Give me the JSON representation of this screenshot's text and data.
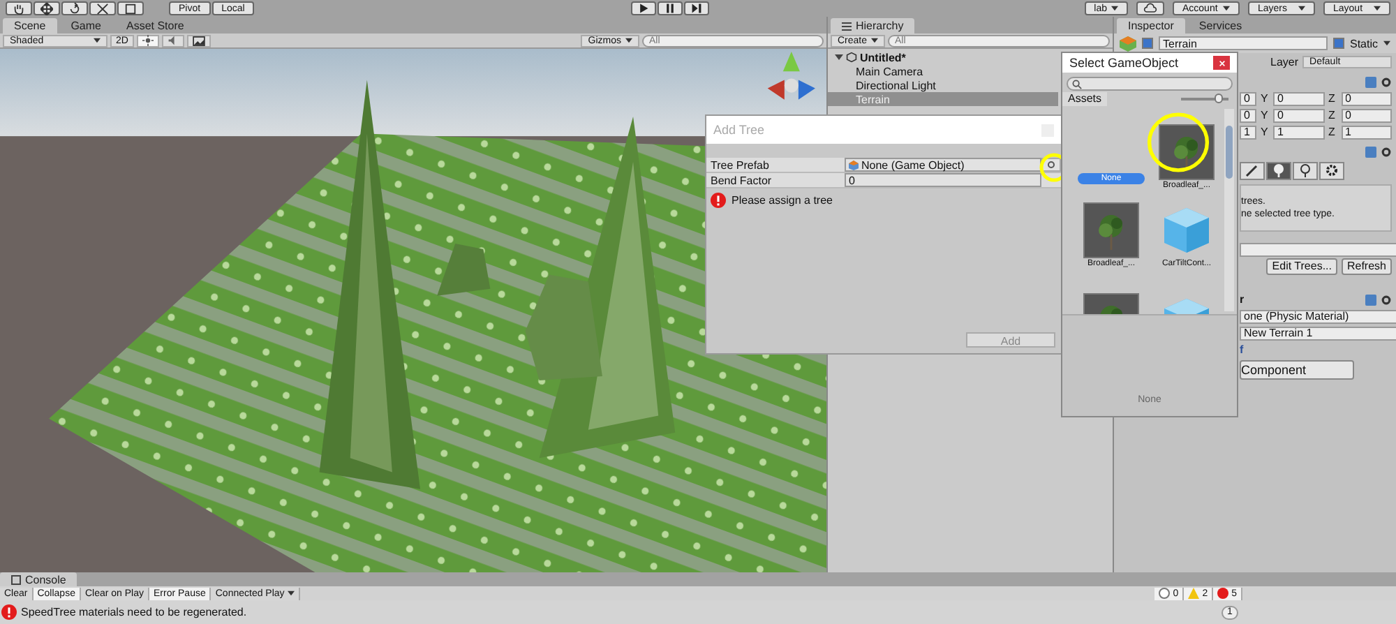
{
  "toolbar": {
    "pivot": "Pivot",
    "local": "Local",
    "collab": "lab",
    "account": "Account",
    "layers": "Layers",
    "layout": "Layout"
  },
  "scene_tabs": [
    {
      "label": "Scene",
      "selected": true
    },
    {
      "label": "Game",
      "selected": false
    },
    {
      "label": "Asset Store",
      "selected": false
    }
  ],
  "scene_toolbar": {
    "shading": "Shaded",
    "mode_2d": "2D",
    "lighting": {
      "on": true
    },
    "audio": {
      "on": false
    },
    "gizmos": "Gizmos",
    "search_placeholder": "All"
  },
  "hierarchy": {
    "title": "Hierarchy",
    "create": "Create",
    "search_placeholder": "All",
    "scene": {
      "label": "Untitled*",
      "expanded": true,
      "children": [
        {
          "label": "Main Camera",
          "selected": false
        },
        {
          "label": "Directional Light",
          "selected": false
        },
        {
          "label": "Terrain",
          "selected": true
        }
      ]
    }
  },
  "inspector": {
    "tabs": [
      {
        "label": "Inspector",
        "selected": true
      },
      {
        "label": "Services",
        "selected": false
      }
    ],
    "object_name": "Terrain",
    "active": true,
    "static": {
      "label": "Static",
      "checked": true
    },
    "layer_label": "Layer",
    "layer": "Default",
    "transform_rows": [
      {
        "cells": [
          "0",
          "Y",
          "0",
          "Z",
          "0"
        ]
      },
      {
        "cells": [
          "0",
          "Y",
          "0",
          "Z",
          "0"
        ]
      },
      {
        "cells": [
          "1",
          "Y",
          "1",
          "Z",
          "1"
        ]
      }
    ],
    "terrain_tools": [
      {
        "kind": "paint",
        "selected": false
      },
      {
        "kind": "trees",
        "selected": true
      },
      {
        "kind": "details",
        "selected": false
      },
      {
        "kind": "settings",
        "selected": false
      }
    ],
    "help_lines": [
      "trees.",
      "ne selected tree type."
    ],
    "buttons": [
      "Edit Trees...",
      "Refresh"
    ],
    "collider_header": "r",
    "collider_fields": [
      "one (Physic Material)",
      "New Terrain 1"
    ],
    "collider_more": "f",
    "add_component": "Component"
  },
  "add_tree": {
    "title": "Add Tree",
    "fields": [
      {
        "label": "Tree Prefab",
        "value": "None (Game Object)",
        "kind": "object"
      },
      {
        "label": "Bend Factor",
        "value": "0",
        "kind": "number"
      }
    ],
    "error": "Please assign a tree",
    "button": "Add"
  },
  "select_object": {
    "title": "Select GameObject",
    "tab": "Assets",
    "zoom": {
      "level": 0.8
    },
    "items": [
      {
        "label": "None",
        "kind": "none",
        "selected": true
      },
      {
        "label": "Broadleaf_...",
        "kind": "tree",
        "selected": false
      },
      {
        "label": "Broadleaf_...",
        "kind": "tree",
        "selected": false
      },
      {
        "label": "CarTiltCont...",
        "kind": "cube",
        "selected": false
      },
      {
        "kind": "tree",
        "selected": false
      },
      {
        "kind": "cube",
        "selected": false
      }
    ],
    "preview_label": "None"
  },
  "console": {
    "title": "Console",
    "buttons": [
      {
        "label": "Clear",
        "on": false
      },
      {
        "label": "Collapse",
        "on": true
      },
      {
        "label": "Clear on Play",
        "on": false
      },
      {
        "label": "Error Pause",
        "on": true
      },
      {
        "label": "Connected Play",
        "on": false
      }
    ],
    "info_count": "0",
    "warning_count": "2",
    "error_count": "5",
    "message": "SpeedTree materials need to be regenerated.",
    "message_count": "1"
  }
}
